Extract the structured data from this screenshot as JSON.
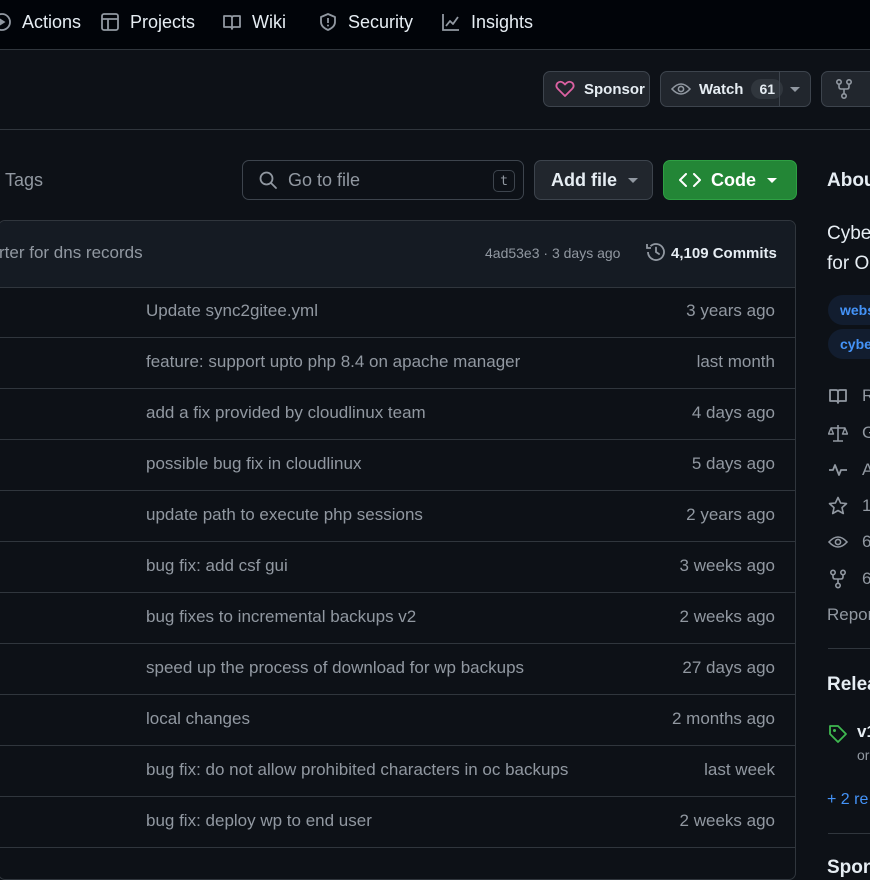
{
  "nav": {
    "items": [
      {
        "label": "Actions",
        "icon": "actions-icon"
      },
      {
        "label": "Projects",
        "icon": "table-icon"
      },
      {
        "label": "Wiki",
        "icon": "book-icon"
      },
      {
        "label": "Security",
        "icon": "shield-icon"
      },
      {
        "label": "Insights",
        "icon": "graph-icon"
      }
    ]
  },
  "header": {
    "sponsor_label": "Sponsor",
    "watch_label": "Watch",
    "watch_count": "61"
  },
  "toolbar": {
    "tags_label": "Tags",
    "search_placeholder": "Go to file",
    "search_shortcut": "t",
    "add_file_label": "Add file",
    "code_label": "Code"
  },
  "latest_commit": {
    "message": "rter for dns records",
    "sha_and_time": "4ad53e3 · 3 days ago",
    "commits_label": "4,109 Commits"
  },
  "files": [
    {
      "message": "Update sync2gitee.yml",
      "date": "3 years ago"
    },
    {
      "message": "feature: support upto php 8.4 on apache manager",
      "date": "last month"
    },
    {
      "message": "add a fix provided by cloudlinux team",
      "date": "4 days ago"
    },
    {
      "message": "possible bug fix in cloudlinux",
      "date": "5 days ago"
    },
    {
      "message": "update path to execute php sessions",
      "date": "2 years ago"
    },
    {
      "message": "bug fix: add csf gui",
      "date": "3 weeks ago"
    },
    {
      "message": "bug fixes to incremental backups v2",
      "date": "2 weeks ago"
    },
    {
      "message": "speed up the process of download for wp backups",
      "date": "27 days ago"
    },
    {
      "message": "local changes",
      "date": "2 months ago"
    },
    {
      "message": "bug fix: do not allow prohibited characters in oc backups",
      "date": "last week"
    },
    {
      "message": "bug fix: deploy wp to end user",
      "date": "2 weeks ago"
    },
    {
      "message": "",
      "date": ""
    }
  ],
  "sidebar": {
    "about_title": "Abou",
    "description_line1": "Cybe",
    "description_line2": "for O",
    "topics": [
      "webs",
      "cybe"
    ],
    "stats": [
      {
        "icon": "book-icon",
        "text": "R"
      },
      {
        "icon": "scale-icon",
        "text": "G"
      },
      {
        "icon": "pulse-icon",
        "text": "A"
      },
      {
        "icon": "star-icon",
        "text": "1."
      },
      {
        "icon": "eye-icon",
        "text": "6"
      },
      {
        "icon": "fork-icon",
        "text": "6"
      }
    ],
    "report_label": "Repor",
    "releases_title": "Relea",
    "release_tag": "v1",
    "release_sub": "or",
    "more_releases": "+ 2 re",
    "sponsor_title": "Spon"
  },
  "colors": {
    "background": "#0d1117",
    "accent_green": "#238636",
    "link_blue": "#4493f8",
    "sponsor_pink": "#db61a2"
  }
}
